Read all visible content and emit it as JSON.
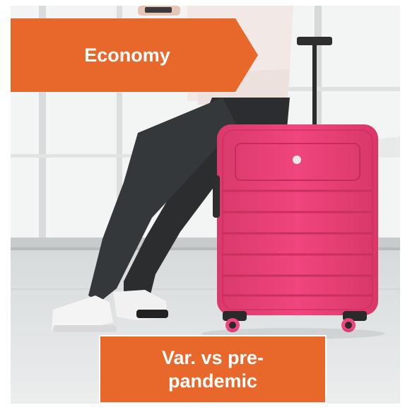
{
  "colors": {
    "badge_orange": "#e8672a",
    "suitcase_pink": "#f0457e",
    "background": "#ffffff"
  },
  "photo": {
    "description_icon": "traveler-sitting-on-suitcase-photo"
  },
  "top_badge": {
    "label": "Economy"
  },
  "bottom_badge": {
    "label": "Var. vs pre-pandemic"
  }
}
